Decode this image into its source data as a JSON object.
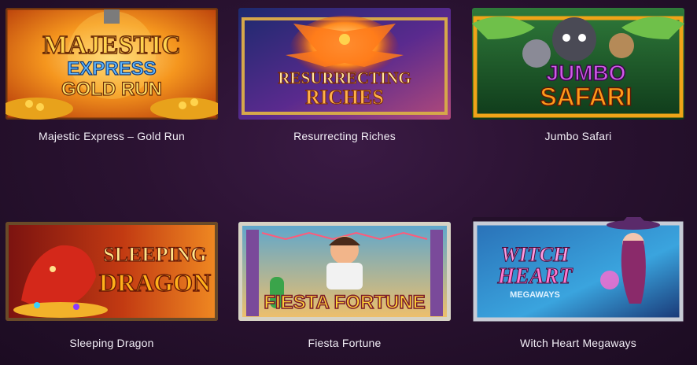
{
  "games": [
    {
      "title": "Majestic Express – Gold Run",
      "logo_lines": [
        "MAJESTIC",
        "EXPRESS",
        "GOLD RUN"
      ],
      "colors": {
        "bg1": "#f06a10",
        "bg2": "#ffc23a",
        "frame": "#7a3a12",
        "text1": "#ffd34d",
        "text2": "#5fb8ff"
      }
    },
    {
      "title": "Resurrecting Riches",
      "logo_lines": [
        "RESURRECTING",
        "RICHES"
      ],
      "colors": {
        "bg1": "#1c2a6e",
        "bg2": "#7a2fa8",
        "frame": "#d6a84a",
        "text1": "#ffe6a0",
        "text2": "#ffb14a"
      }
    },
    {
      "title": "Jumbo Safari",
      "logo_lines": [
        "JUMBO",
        "SAFARI"
      ],
      "colors": {
        "bg1": "#1e5a2a",
        "bg2": "#79b63a",
        "frame": "#e8a21b",
        "text1": "#c44be0",
        "text2": "#ff9a1a"
      }
    },
    {
      "title": "Sleeping Dragon",
      "logo_lines": [
        "SLEEPING",
        "DRAGON"
      ],
      "colors": {
        "bg1": "#8a1710",
        "bg2": "#e5581c",
        "frame": "#6a4a28",
        "text1": "#ffe68a",
        "text2": "#ffb11a"
      }
    },
    {
      "title": "Fiesta Fortune",
      "logo_lines": [
        "FIESTA FORTUNE"
      ],
      "colors": {
        "bg1": "#3a86b5",
        "bg2": "#f2c068",
        "frame": "#d7d3c5",
        "text1": "#ffd53a",
        "text2": "#c43a3a"
      }
    },
    {
      "title": "Witch Heart Megaways",
      "logo_lines": [
        "WITCH",
        "HEART",
        "MEGAWAYS"
      ],
      "colors": {
        "bg1": "#173c78",
        "bg2": "#3aa4de",
        "frame": "#c8ccd6",
        "text1": "#ff9ce0",
        "text2": "#e0f2ff"
      }
    }
  ]
}
